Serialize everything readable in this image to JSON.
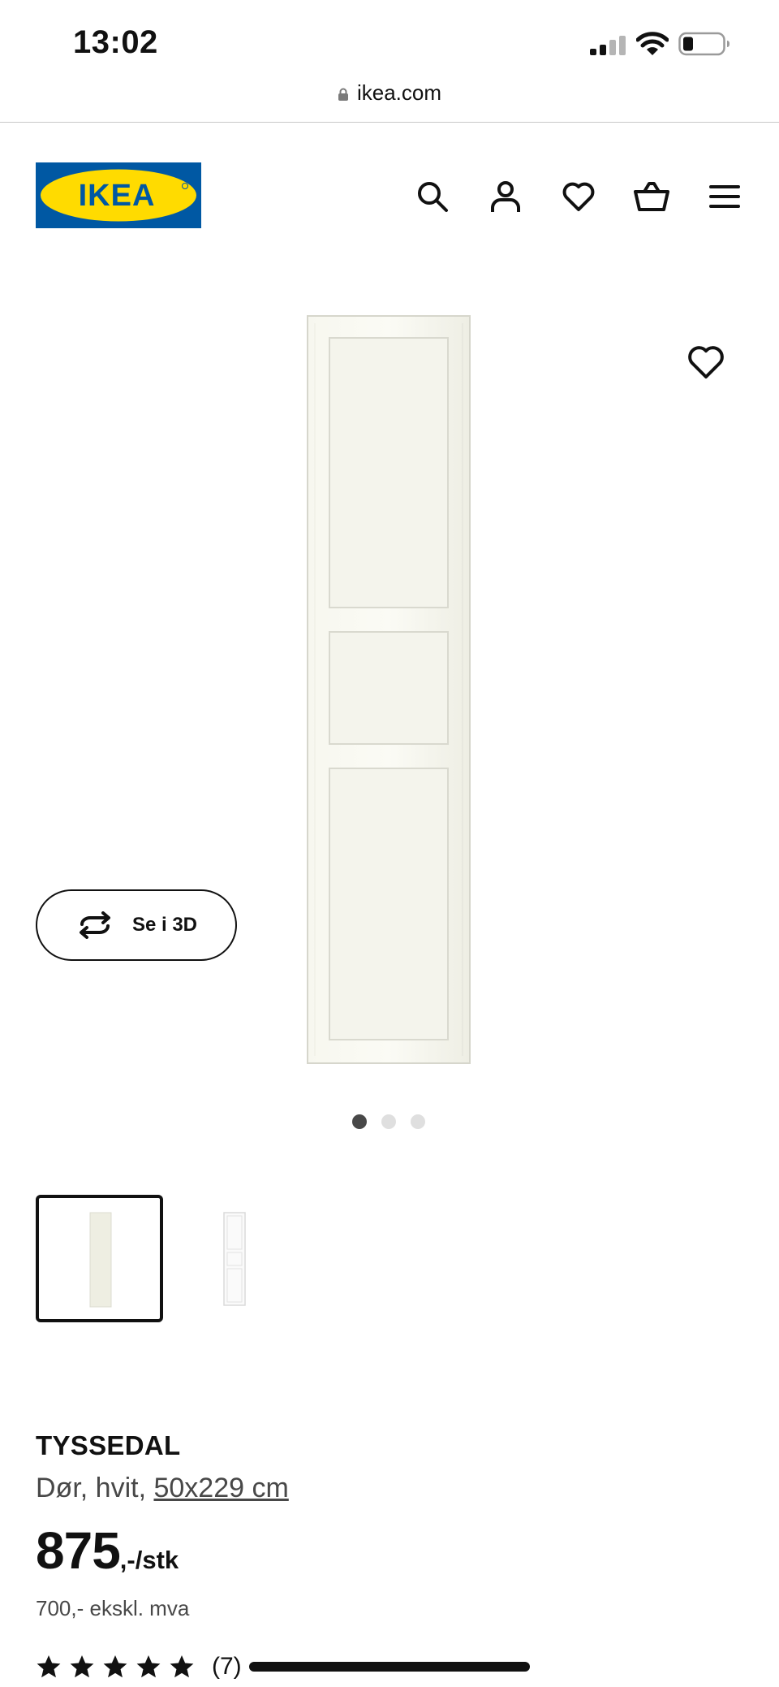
{
  "status_bar": {
    "time": "13:02"
  },
  "browser": {
    "url": "ikea.com"
  },
  "header": {
    "logo_text": "IKEA",
    "icons": [
      "search-icon",
      "profile-icon",
      "heart-icon",
      "basket-icon",
      "menu-icon"
    ]
  },
  "gallery": {
    "view_3d_label": "Se i 3D",
    "dot_count": 3,
    "active_dot": 1,
    "thumbnail_count": 2,
    "selected_thumbnail": 1
  },
  "product": {
    "name": "TYSSEDAL",
    "description_prefix": "Dør, hvit, ",
    "size": "50x229 cm",
    "price": "875",
    "price_suffix": ",-/stk",
    "price_excl_vat": "700,- ekskl. mva",
    "rating_stars": 5,
    "review_count": "(7)"
  },
  "colors": {
    "ikea_blue": "#0058A3",
    "ikea_yellow": "#FFDB00",
    "text_primary": "#111111",
    "text_secondary": "#484848"
  }
}
